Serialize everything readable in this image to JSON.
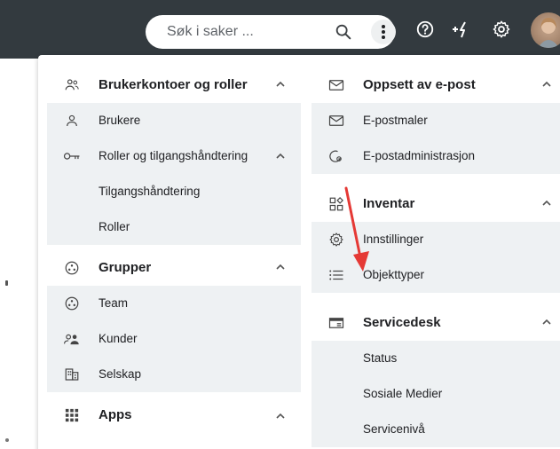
{
  "search": {
    "placeholder": "Søk i saker ..."
  },
  "topbar": {
    "icons": [
      "search-icon",
      "more-vert-icon",
      "help-icon",
      "quick-create-icon",
      "settings-gear-icon"
    ],
    "quick_create_label": "+⚡"
  },
  "left_column": {
    "sections": [
      {
        "title": "Brukerkontoer og roller",
        "icon": "users-icon",
        "items": [
          {
            "label": "Brukere",
            "icon": "user-icon"
          },
          {
            "label": "Roller og tilgangshåndtering",
            "icon": "key-icon"
          },
          {
            "label": "Tilgangshåndtering",
            "icon": ""
          },
          {
            "label": "Roller",
            "icon": ""
          }
        ]
      },
      {
        "title": "Grupper",
        "icon": "group-circle-icon",
        "items": [
          {
            "label": "Team",
            "icon": "group-circle-icon"
          },
          {
            "label": "Kunder",
            "icon": "customers-icon"
          },
          {
            "label": "Selskap",
            "icon": "building-icon"
          }
        ]
      },
      {
        "title": "Apps",
        "icon": "apps-grid-icon",
        "items": []
      }
    ]
  },
  "right_column": {
    "sections": [
      {
        "title": "Oppsett av e-post",
        "icon": "mail-icon",
        "items": [
          {
            "label": "E-postmaler",
            "icon": "mail-icon"
          },
          {
            "label": "E-postadministrasjon",
            "icon": "mail-settings-icon"
          }
        ]
      },
      {
        "title": "Inventar",
        "icon": "inventory-icon",
        "items": [
          {
            "label": "Innstillinger",
            "icon": "gear-icon"
          },
          {
            "label": "Objekttyper",
            "icon": "list-icon"
          }
        ]
      },
      {
        "title": "Servicedesk",
        "icon": "servicedesk-icon",
        "items": [
          {
            "label": "Status",
            "icon": ""
          },
          {
            "label": "Sosiale Medier",
            "icon": ""
          },
          {
            "label": "Servicenivå",
            "icon": ""
          }
        ]
      }
    ]
  },
  "colors": {
    "topbar": "#333a3f",
    "submenu_bg": "#eef1f3",
    "annotation_arrow": "#e53935"
  }
}
